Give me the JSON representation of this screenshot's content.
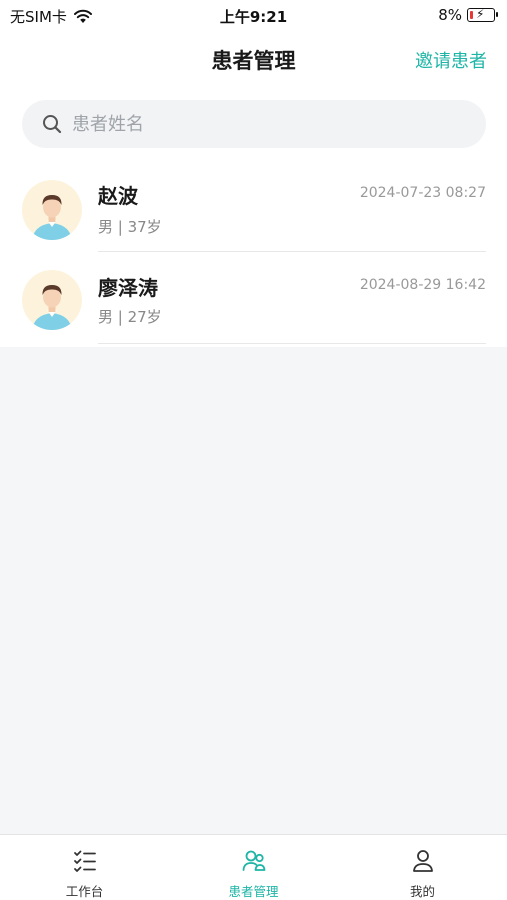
{
  "status_bar": {
    "carrier": "无SIM卡",
    "time": "上午9:21",
    "battery": "8%"
  },
  "header": {
    "title": "患者管理",
    "action_label": "邀请患者"
  },
  "search": {
    "placeholder": "患者姓名",
    "value": ""
  },
  "patients": [
    {
      "name": "赵波",
      "info": "男 | 37岁",
      "time": "2024-07-23 08:27"
    },
    {
      "name": "廖泽涛",
      "info": "男 | 27岁",
      "time": "2024-08-29 16:42"
    }
  ],
  "tabs": [
    {
      "label": "工作台",
      "icon": "checklist-icon",
      "active": false
    },
    {
      "label": "患者管理",
      "icon": "users-icon",
      "active": true
    },
    {
      "label": "我的",
      "icon": "person-icon",
      "active": false
    }
  ],
  "colors": {
    "accent": "#1fb5a6",
    "background": "#f5f6f8",
    "avatar_bg": "#fdf3dc",
    "battery_low": "#e53935"
  }
}
